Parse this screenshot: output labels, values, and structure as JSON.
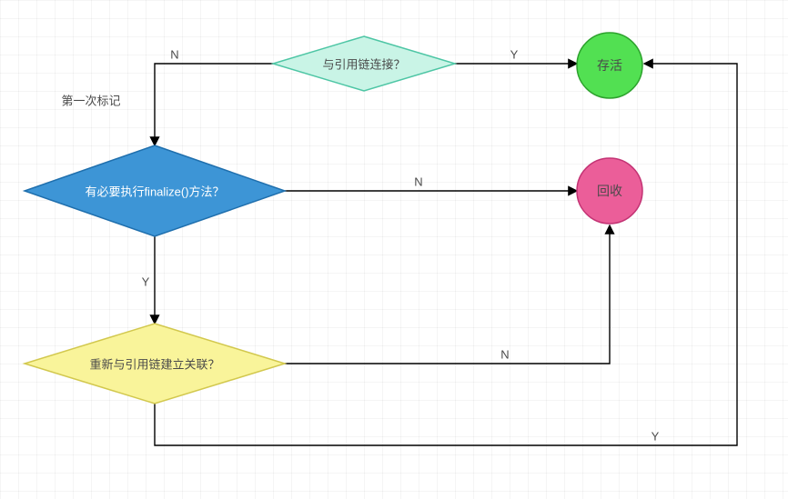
{
  "nodes": {
    "d1": {
      "label": "与引用链连接？"
    },
    "d2": {
      "label": "有必要执行finalize()方法？"
    },
    "d3": {
      "label": "重新与引用链建立关联？"
    },
    "c1": {
      "label": "存活"
    },
    "c2": {
      "label": "回收"
    }
  },
  "edges": {
    "d1_no": "N",
    "d1_yes": "Y",
    "first_mark": "第一次标记",
    "d2_no": "N",
    "d2_yes": "Y",
    "d3_no": "N",
    "d3_yes": "Y"
  },
  "colors": {
    "d1_fill": "#C9F4E6",
    "d1_stroke": "#4EC6A5",
    "d2_fill": "#3D95D6",
    "d2_stroke": "#1F6FAD",
    "d3_fill": "#F9F49A",
    "d3_stroke": "#D2C84E",
    "c1_fill": "#52E052",
    "c1_stroke": "#2DA22D",
    "c2_fill": "#EB5E99",
    "c2_stroke": "#C33374",
    "arrow": "#000000"
  }
}
